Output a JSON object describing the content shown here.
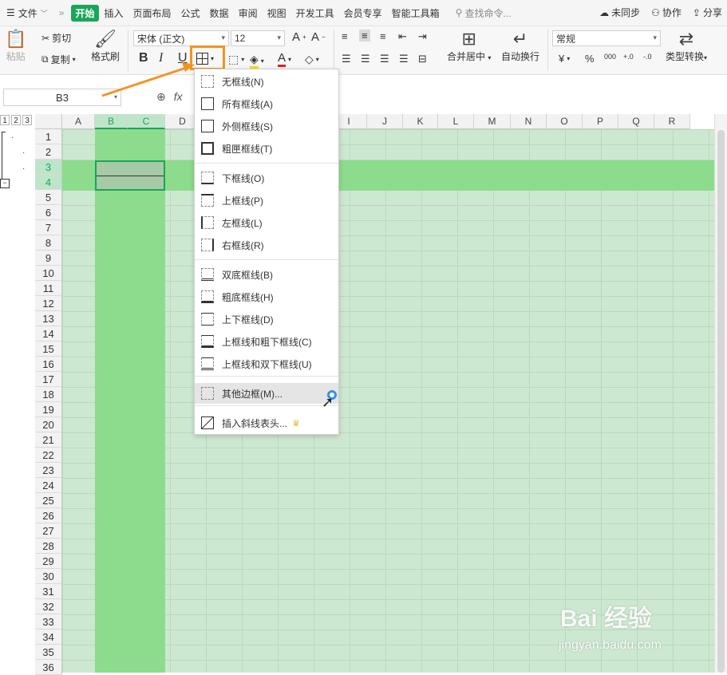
{
  "menubar": {
    "file_label": "文件",
    "tabs": [
      "开始",
      "插入",
      "页面布局",
      "公式",
      "数据",
      "审阅",
      "视图",
      "开发工具",
      "会员专享",
      "智能工具箱"
    ],
    "search_placeholder": "查找命令...",
    "right": {
      "sync": "未同步",
      "collab": "协作",
      "share": "分享"
    }
  },
  "ribbon": {
    "paste": "粘贴",
    "cut": "剪切",
    "copy": "复制",
    "format_painter": "格式刷",
    "font_name": "宋体 (正文)",
    "font_size": "12",
    "merge_center": "合并居中",
    "wrap_text": "自动换行",
    "number_format": "常规",
    "type_convert": "类型转换",
    "bold": "B",
    "italic": "I",
    "underline": "U",
    "currency": "¥",
    "percent": "%",
    "thousands": "000",
    "dec_inc": "+.0",
    "dec_dec": "-.0"
  },
  "formula": {
    "cell_ref": "B3",
    "fx": "fx"
  },
  "outline_levels": [
    "1",
    "2",
    "3"
  ],
  "columns": [
    "A",
    "B",
    "C",
    "D",
    "E",
    "F",
    "G",
    "H",
    "I",
    "J",
    "K",
    "L",
    "M",
    "N",
    "O",
    "P",
    "Q",
    "R"
  ],
  "selected_columns": [
    "B",
    "C"
  ],
  "selected_rows": [
    3,
    4
  ],
  "rows": [
    "1",
    "2",
    "3",
    "4",
    "5",
    "6",
    "7",
    "8",
    "9",
    "10",
    "11",
    "12",
    "13",
    "14",
    "15",
    "16",
    "17",
    "18",
    "19",
    "20",
    "21",
    "22",
    "23",
    "24",
    "25",
    "26",
    "27",
    "28",
    "29",
    "30",
    "31",
    "32",
    "33",
    "34",
    "35",
    "36"
  ],
  "border_menu": {
    "items": [
      {
        "label": "无框线(N)",
        "icon": "no-border-icon"
      },
      {
        "label": "所有框线(A)",
        "icon": "all-borders-icon"
      },
      {
        "label": "外侧框线(S)",
        "icon": "outside-borders-icon"
      },
      {
        "label": "粗匣框线(T)",
        "icon": "thick-box-border-icon"
      },
      {
        "label": "下框线(O)",
        "icon": "bottom-border-icon"
      },
      {
        "label": "上框线(P)",
        "icon": "top-border-icon"
      },
      {
        "label": "左框线(L)",
        "icon": "left-border-icon"
      },
      {
        "label": "右框线(R)",
        "icon": "right-border-icon"
      },
      {
        "label": "双底框线(B)",
        "icon": "double-bottom-border-icon"
      },
      {
        "label": "粗底框线(H)",
        "icon": "thick-bottom-border-icon"
      },
      {
        "label": "上下框线(D)",
        "icon": "top-bottom-border-icon"
      },
      {
        "label": "上框线和粗下框线(C)",
        "icon": "top-thick-bottom-border-icon"
      },
      {
        "label": "上框线和双下框线(U)",
        "icon": "top-double-bottom-border-icon"
      },
      {
        "label": "其他边框(M)...",
        "icon": "more-borders-icon"
      },
      {
        "label": "插入斜线表头...",
        "icon": "diagonal-header-icon"
      }
    ]
  },
  "watermark": {
    "brand": "Bai 经验",
    "url": "jingyan.baidu.com"
  },
  "colors": {
    "accent": "#1aa55a",
    "highlight_box": "#f39421",
    "selected_band": "#8ddc8d",
    "sheet_bg": "#cde8d1"
  }
}
